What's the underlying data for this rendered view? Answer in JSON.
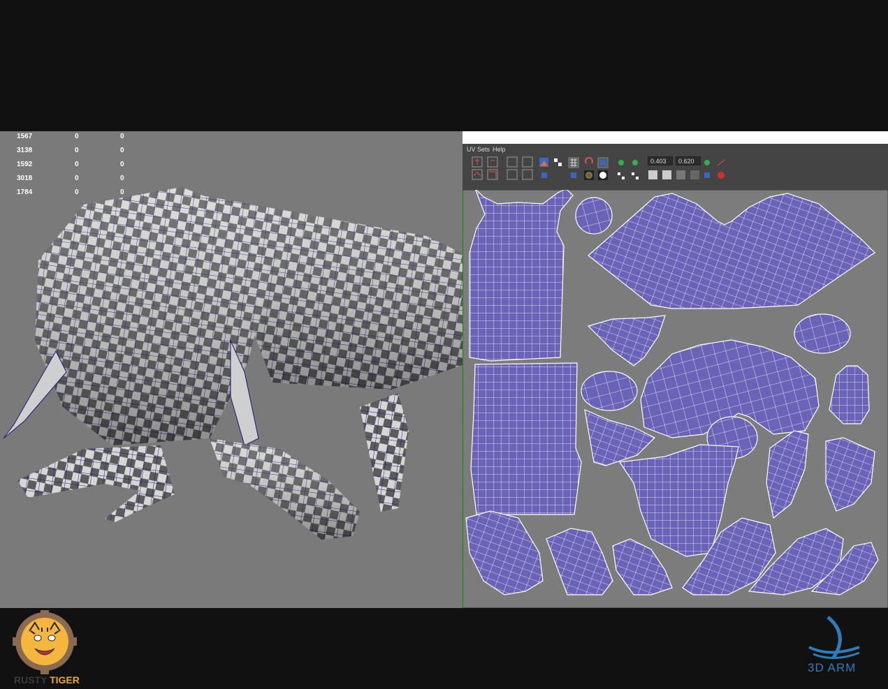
{
  "stats": [
    {
      "a": "1567",
      "b": "0",
      "c": "0"
    },
    {
      "a": "3138",
      "b": "0",
      "c": "0"
    },
    {
      "a": "1592",
      "b": "0",
      "c": "0"
    },
    {
      "a": "3018",
      "b": "0",
      "c": "0"
    },
    {
      "a": "1784",
      "b": "0",
      "c": "0"
    }
  ],
  "uv_editor": {
    "menu": [
      "UV Sets",
      "Help"
    ],
    "field_u": "0.403",
    "field_v": "0.620"
  },
  "branding": {
    "left_logo_a": "RUSTY",
    "left_logo_b": "TIGER",
    "right_logo": "3D ARM"
  },
  "colors": {
    "uv_shell": "#6a63b8",
    "uv_line": "#ffffff",
    "viewport_bg": "#7a7a7a",
    "wireframe": "#1a1a7a"
  }
}
